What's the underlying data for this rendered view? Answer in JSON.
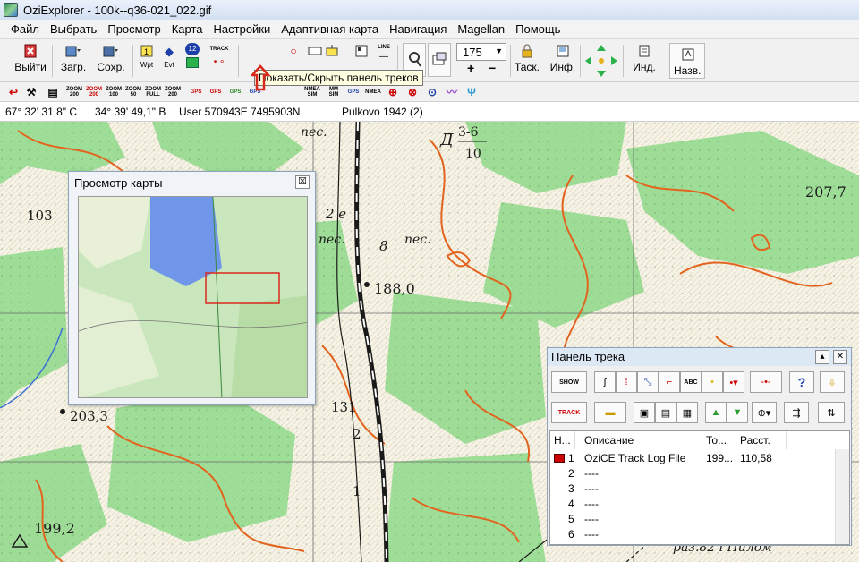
{
  "window": {
    "title": "OziExplorer - 100k--q36-021_022.gif"
  },
  "menu": [
    "Файл",
    "Выбрать",
    "Просмотр",
    "Карта",
    "Настройки",
    "Адаптивная карта",
    "Навигация",
    "Magellan",
    "Помощь"
  ],
  "toolbar": {
    "exit": "Выйти",
    "load": "Загр.",
    "save": "Сохр.",
    "wpt": "Wpt",
    "evt": "Evt",
    "badge": "12",
    "track": "TRACK",
    "line_icon": "LINE",
    "zoom_value": "175",
    "task": "Таск.",
    "info": "Инф.",
    "ind": "Инд.",
    "name": "Назв."
  },
  "toolbar2_labels": [
    "ZOOM 200",
    "ZOOM 200",
    "ZOOM 100",
    "ZOOM 50",
    "ZOOM FULL",
    "ZOOM 200",
    "GPS",
    "GPS",
    "GPS",
    "GPS",
    "NMEA SIM",
    "MM SIM",
    "GPS",
    "NMEA"
  ],
  "tooltip": "Показать/Скрыть панель треков",
  "status": {
    "lat": "67° 32' 31,8\" С",
    "lon": "34° 39' 49,1\" В",
    "user": "User  570943E  7495903N",
    "datum": "Pulkovo 1942 (2)"
  },
  "map_labels": [
    "пес.",
    "пес.",
    "пес.",
    "2 е",
    "8",
    "188,0",
    "203,3",
    "199,2",
    "207,7",
    "103",
    "131",
    "2",
    "1",
    "Д",
    "3-6",
    "10",
    "раз.82 і Пилом"
  ],
  "preview": {
    "title": "Просмотр карты",
    "close": "☒"
  },
  "track_panel": {
    "title": "Панель трека",
    "show_label": "SHOW",
    "abc_label": "ABC",
    "track_label": "TRACK",
    "help_label": "?",
    "headers": [
      "Н...",
      "Описание",
      "То...",
      "Расст."
    ],
    "rows": [
      {
        "num": "1",
        "color": "#cc0000",
        "desc": "OziCE Track Log File",
        "points": "199...",
        "dist": "110,58"
      },
      {
        "num": "2",
        "desc": "----"
      },
      {
        "num": "3",
        "desc": "----"
      },
      {
        "num": "4",
        "desc": "----"
      },
      {
        "num": "5",
        "desc": "----"
      },
      {
        "num": "6",
        "desc": "----"
      }
    ]
  },
  "colors": {
    "forest": "#8fd98a",
    "contour": "#e2641e",
    "water": "#3a6fd8",
    "road": "#1a1a1a"
  }
}
